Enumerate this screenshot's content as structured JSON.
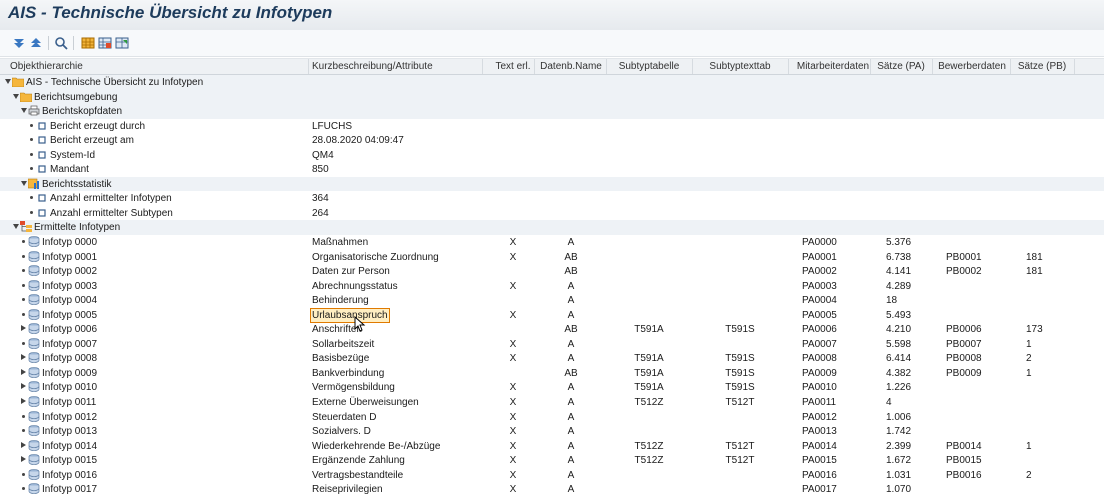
{
  "title": "AIS - Technische Übersicht zu Infotypen",
  "toolbar": {
    "icons": [
      "expand-all-icon",
      "collapse-all-icon",
      "details-icon",
      "layout-icon",
      "hierarchy-icon",
      "export-icon"
    ]
  },
  "columns": [
    "Objekthierarchie",
    "Kurzbeschreibung/Attribute",
    "Text erl.",
    "Datenb.Name",
    "Subtyptabelle",
    "Subtyptexttab",
    "Mitarbeiterdaten",
    "Sätze (PA)",
    "Bewerberdaten",
    "Sätze (PB)"
  ],
  "colors": {
    "title": "#1d3b5c",
    "header_bg": "#eef1f4",
    "group_bg": "#eef2f6",
    "highlight_border": "#e07a00"
  },
  "rows": [
    {
      "level": 0,
      "exp": "down",
      "icon": "folder-icon",
      "label": "AIS - Technische Übersicht zu Infotypen",
      "group": true
    },
    {
      "level": 1,
      "exp": "down",
      "icon": "folder-icon",
      "label": "Berichtsumgebung",
      "group": true
    },
    {
      "level": 2,
      "exp": "down",
      "icon": "printer-icon",
      "label": "Berichtskopfdaten",
      "group": true
    },
    {
      "level": 3,
      "icon": "attribute-icon",
      "label": "Bericht erzeugt durch",
      "desc": "LFUCHS"
    },
    {
      "level": 3,
      "icon": "attribute-icon",
      "label": "Bericht erzeugt am",
      "desc": "28.08.2020 04:09:47"
    },
    {
      "level": 3,
      "icon": "attribute-icon",
      "label": "System-Id",
      "desc": "QM4"
    },
    {
      "level": 3,
      "icon": "attribute-icon",
      "label": "Mandant",
      "desc": "850"
    },
    {
      "level": 2,
      "exp": "down",
      "icon": "statistics-icon",
      "label": "Berichtsstatistik",
      "group": true
    },
    {
      "level": 3,
      "icon": "attribute-icon",
      "label": "Anzahl ermittelter Infotypen",
      "desc": "364"
    },
    {
      "level": 3,
      "icon": "attribute-icon",
      "label": "Anzahl ermittelter Subtypen",
      "desc": "264"
    },
    {
      "level": 1,
      "exp": "down",
      "icon": "hierarchy-node-icon",
      "label": "Ermittelte Infotypen",
      "group": true
    },
    {
      "level": 2,
      "icon": "table-icon",
      "label": "Infotyp 0000",
      "desc": "Maßnahmen",
      "text": "X",
      "db": "A",
      "pa": "PA0000",
      "spa": "5.376"
    },
    {
      "level": 2,
      "icon": "table-icon",
      "label": "Infotyp 0001",
      "desc": "Organisatorische Zuordnung",
      "text": "X",
      "db": "AB",
      "pa": "PA0001",
      "spa": "6.738",
      "pb": "PB0001",
      "spb": "181"
    },
    {
      "level": 2,
      "icon": "table-icon",
      "label": "Infotyp 0002",
      "desc": "Daten zur Person",
      "db": "AB",
      "pa": "PA0002",
      "spa": "4.141",
      "pb": "PB0002",
      "spb": "181"
    },
    {
      "level": 2,
      "icon": "table-icon",
      "label": "Infotyp 0003",
      "desc": "Abrechnungsstatus",
      "text": "X",
      "db": "A",
      "pa": "PA0003",
      "spa": "4.289"
    },
    {
      "level": 2,
      "icon": "table-icon",
      "label": "Infotyp 0004",
      "desc": "Behinderung",
      "db": "A",
      "pa": "PA0004",
      "spa": "18"
    },
    {
      "level": 2,
      "icon": "table-icon",
      "label": "Infotyp 0005",
      "desc": "Urlaubsanspruch",
      "text": "X",
      "db": "A",
      "pa": "PA0005",
      "spa": "5.493",
      "highlight": true
    },
    {
      "level": 2,
      "exp": "right",
      "icon": "table-icon",
      "label": "Infotyp 0006",
      "desc": "Anschriften",
      "db": "AB",
      "st": "T591A",
      "stt": "T591S",
      "pa": "PA0006",
      "spa": "4.210",
      "pb": "PB0006",
      "spb": "173"
    },
    {
      "level": 2,
      "icon": "table-icon",
      "label": "Infotyp 0007",
      "desc": "Sollarbeitszeit",
      "text": "X",
      "db": "A",
      "pa": "PA0007",
      "spa": "5.598",
      "pb": "PB0007",
      "spb": "1"
    },
    {
      "level": 2,
      "exp": "right",
      "icon": "table-icon",
      "label": "Infotyp 0008",
      "desc": "Basisbezüge",
      "text": "X",
      "db": "A",
      "st": "T591A",
      "stt": "T591S",
      "pa": "PA0008",
      "spa": "6.414",
      "pb": "PB0008",
      "spb": "2"
    },
    {
      "level": 2,
      "exp": "right",
      "icon": "table-icon",
      "label": "Infotyp 0009",
      "desc": "Bankverbindung",
      "db": "AB",
      "st": "T591A",
      "stt": "T591S",
      "pa": "PA0009",
      "spa": "4.382",
      "pb": "PB0009",
      "spb": "1"
    },
    {
      "level": 2,
      "exp": "right",
      "icon": "table-icon",
      "label": "Infotyp 0010",
      "desc": "Vermögensbildung",
      "text": "X",
      "db": "A",
      "st": "T591A",
      "stt": "T591S",
      "pa": "PA0010",
      "spa": "1.226"
    },
    {
      "level": 2,
      "exp": "right",
      "icon": "table-icon",
      "label": "Infotyp 0011",
      "desc": "Externe Überweisungen",
      "text": "X",
      "db": "A",
      "st": "T512Z",
      "stt": "T512T",
      "pa": "PA0011",
      "spa": "4"
    },
    {
      "level": 2,
      "icon": "table-icon",
      "label": "Infotyp 0012",
      "desc": "Steuerdaten D",
      "text": "X",
      "db": "A",
      "pa": "PA0012",
      "spa": "1.006"
    },
    {
      "level": 2,
      "icon": "table-icon",
      "label": "Infotyp 0013",
      "desc": "Sozialvers. D",
      "text": "X",
      "db": "A",
      "pa": "PA0013",
      "spa": "1.742"
    },
    {
      "level": 2,
      "exp": "right",
      "icon": "table-icon",
      "label": "Infotyp 0014",
      "desc": "Wiederkehrende Be-/Abzüge",
      "text": "X",
      "db": "A",
      "st": "T512Z",
      "stt": "T512T",
      "pa": "PA0014",
      "spa": "2.399",
      "pb": "PB0014",
      "spb": "1"
    },
    {
      "level": 2,
      "exp": "right",
      "icon": "table-icon",
      "label": "Infotyp 0015",
      "desc": "Ergänzende Zahlung",
      "text": "X",
      "db": "A",
      "st": "T512Z",
      "stt": "T512T",
      "pa": "PA0015",
      "spa": "1.672",
      "pb": "PB0015"
    },
    {
      "level": 2,
      "icon": "table-icon",
      "label": "Infotyp 0016",
      "desc": "Vertragsbestandteile",
      "text": "X",
      "db": "A",
      "pa": "PA0016",
      "spa": "1.031",
      "pb": "PB0016",
      "spb": "2"
    },
    {
      "level": 2,
      "icon": "table-icon",
      "label": "Infotyp 0017",
      "desc": "Reiseprivilegien",
      "text": "X",
      "db": "A",
      "pa": "PA0017",
      "spa": "1.070"
    }
  ]
}
